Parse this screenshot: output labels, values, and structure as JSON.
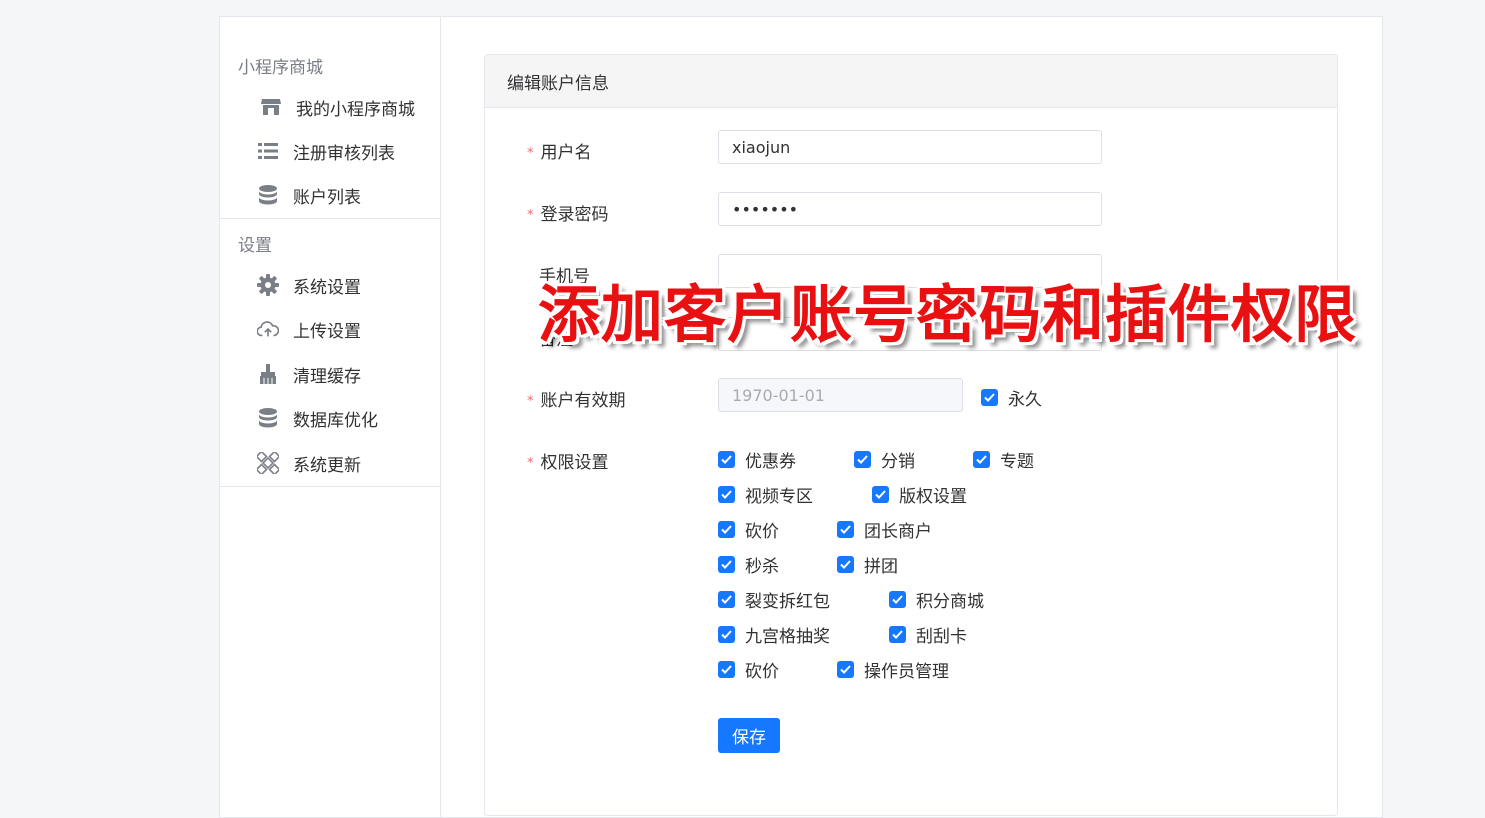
{
  "sidebar": {
    "groups": [
      {
        "title": "小程序商城",
        "items": [
          {
            "label": "我的小程序商城",
            "icon": "store-icon"
          },
          {
            "label": "注册审核列表",
            "icon": "list-icon"
          },
          {
            "label": "账户列表",
            "icon": "database-icon"
          }
        ]
      },
      {
        "title": "设置",
        "items": [
          {
            "label": "系统设置",
            "icon": "gear-icon"
          },
          {
            "label": "上传设置",
            "icon": "cloud-upload-icon"
          },
          {
            "label": "清理缓存",
            "icon": "broom-icon"
          },
          {
            "label": "数据库优化",
            "icon": "database-icon"
          },
          {
            "label": "系统更新",
            "icon": "update-icon"
          }
        ]
      }
    ]
  },
  "card": {
    "title": "编辑账户信息",
    "fields": {
      "username": {
        "label": "用户名",
        "value": "xiaojun"
      },
      "password": {
        "label": "登录密码",
        "value": "•••••••"
      },
      "phone": {
        "label": "手机号",
        "value": ""
      },
      "remark": {
        "label": "备注",
        "value": ""
      },
      "expiry": {
        "label": "账户有效期",
        "value": "1970-01-01",
        "forever_label": "永久",
        "forever_checked": true
      }
    },
    "permissions_label": "权限设置",
    "permissions": [
      [
        "优惠券",
        "分销",
        "专题"
      ],
      [
        "视频专区",
        "版权设置"
      ],
      [
        "砍价",
        "团长商户"
      ],
      [
        "秒杀",
        "拼团"
      ],
      [
        "裂变拆红包",
        "积分商城"
      ],
      [
        "九宫格抽奖",
        "刮刮卡"
      ],
      [
        "砍价",
        "操作员管理"
      ]
    ],
    "save_label": "保存"
  },
  "overlay_banner": "添加客户账号密码和插件权限",
  "colors": {
    "primary": "#1677ff",
    "required": "#f56c6c",
    "banner": "#e81010"
  }
}
